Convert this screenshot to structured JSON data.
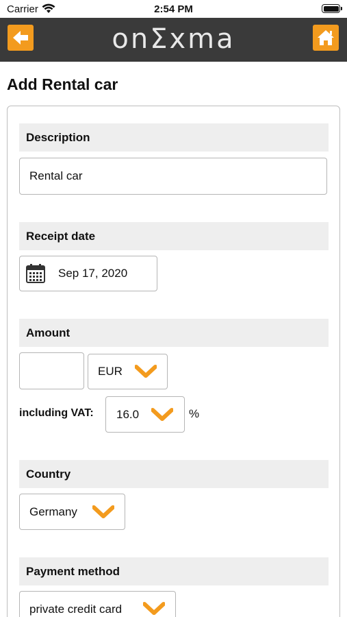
{
  "status_bar": {
    "carrier": "Carrier",
    "time": "2:54 PM"
  },
  "header": {
    "logo": "onΣxma",
    "accent_color": "#f39b1e",
    "bar_color": "#3a3a3a",
    "back_icon": "arrow-left-icon",
    "home_icon": "home-icon"
  },
  "page": {
    "title": "Add Rental car"
  },
  "form": {
    "description": {
      "label": "Description",
      "value": "Rental car"
    },
    "receipt_date": {
      "label": "Receipt date",
      "value": "Sep 17, 2020",
      "icon": "calendar-icon"
    },
    "amount": {
      "label": "Amount",
      "value": "",
      "currency": "EUR",
      "vat_label": "including VAT:",
      "vat_value": "16.0",
      "vat_unit": "%"
    },
    "country": {
      "label": "Country",
      "value": "Germany"
    },
    "payment_method": {
      "label": "Payment method",
      "value": "private credit card"
    }
  }
}
